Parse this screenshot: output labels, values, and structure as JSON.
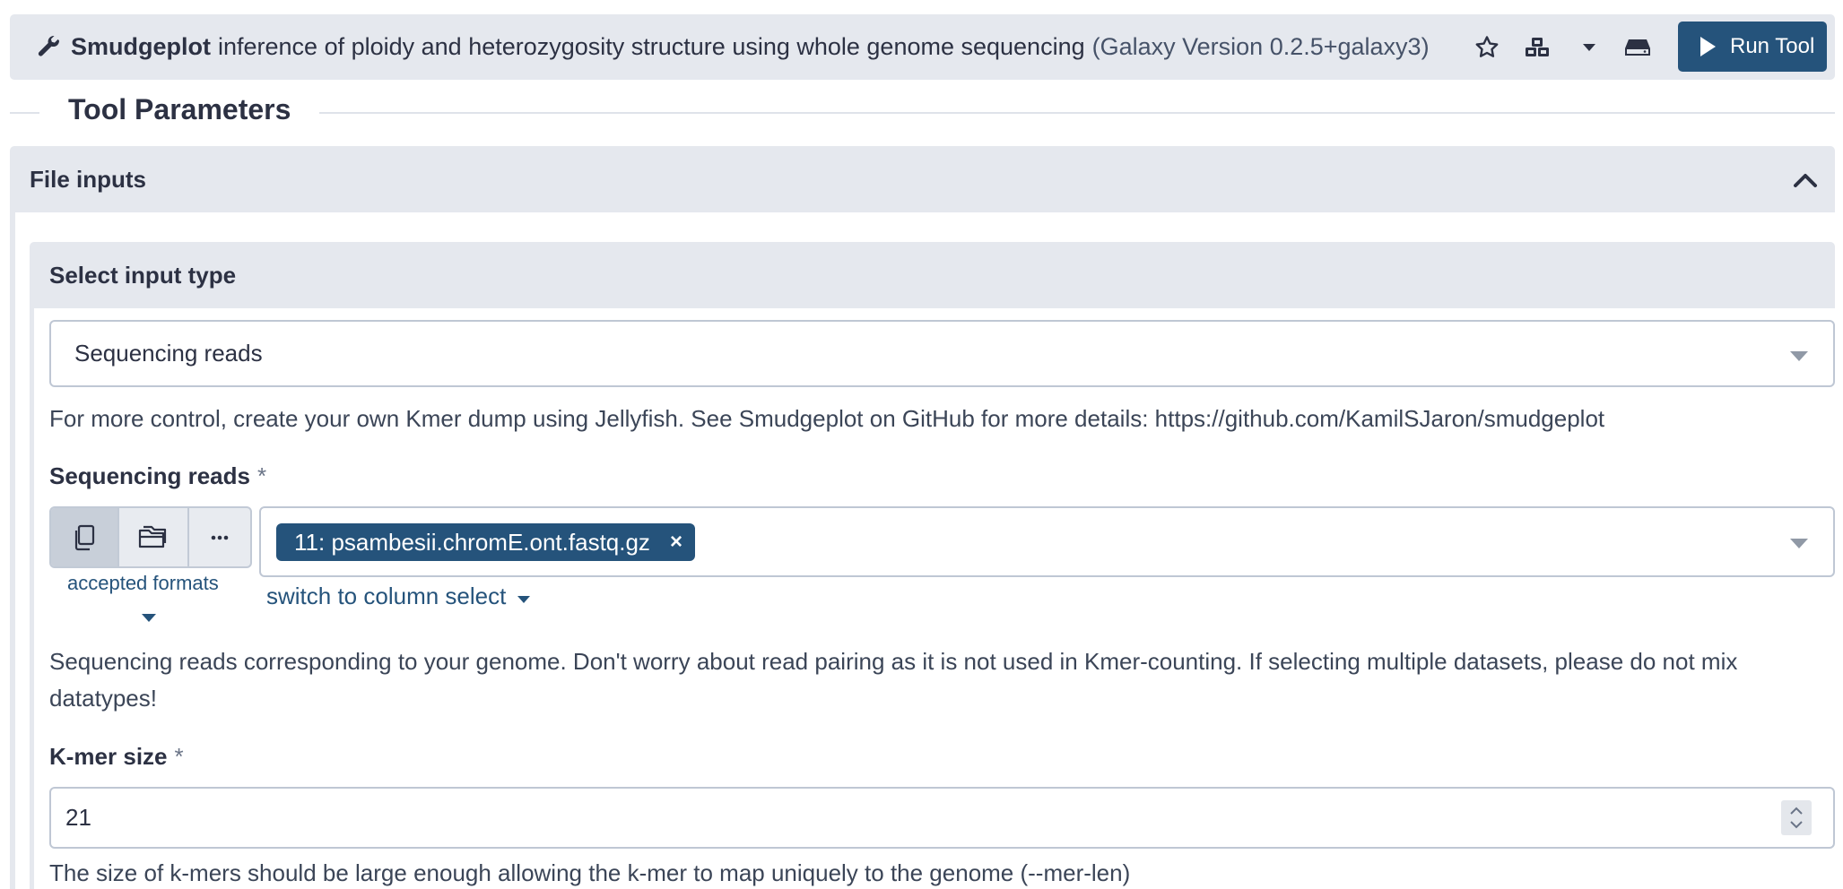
{
  "header": {
    "tool_name": "Smudgeplot",
    "tool_description": "inference of ploidy and heterozygosity structure using whole genome sequencing",
    "tool_version": "(Galaxy Version 0.2.5+galaxy3)",
    "run_label": "Run Tool",
    "icons": [
      "wrench-icon",
      "star-icon",
      "cubes-icon",
      "caret-down-icon",
      "hdd-icon",
      "play-icon"
    ]
  },
  "params_title": "Tool Parameters",
  "file_inputs": {
    "title": "File inputs",
    "input_type": {
      "title": "Select input type",
      "selected": "Sequencing reads",
      "help": "For more control, create your own Kmer dump using Jellyfish. See Smudgeplot on GitHub for more details: https://github.com/KamilSJaron/smudgeplot"
    },
    "sequencing_reads": {
      "label": "Sequencing reads",
      "required_mark": "*",
      "dataset_chip": "11: psambesii.chromE.ont.fastq.gz",
      "chip_remove": "×",
      "accepted_formats": "accepted formats",
      "switch_link": "switch to column select",
      "help": "Sequencing reads corresponding to your genome. Don't worry about read pairing as it is not used in Kmer-counting. If selecting multiple datasets, please do not mix",
      "help_cont": "datatypes!"
    },
    "kmer_size": {
      "label": "K-mer size",
      "required_mark": "*",
      "value": "21",
      "help": "The size of k-mers should be large enough allowing the k-mer to map uniquely to the genome (--mer-len)"
    }
  },
  "colors": {
    "primary": "#25537b",
    "header_bg": "#e5e8ee",
    "text": "#2c3143"
  }
}
